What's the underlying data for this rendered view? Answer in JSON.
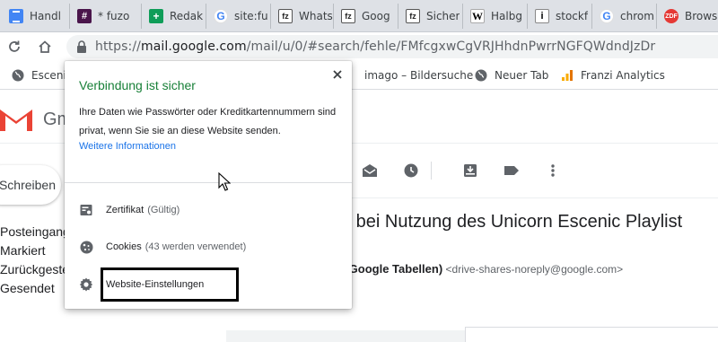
{
  "tabs": [
    {
      "label": "Handl",
      "icon": "google-docs-icon"
    },
    {
      "label": "* fuzo",
      "icon": "slack-icon"
    },
    {
      "label": "Redak",
      "icon": "google-sheets-icon"
    },
    {
      "label": "site:fu",
      "icon": "google-icon"
    },
    {
      "label": "Whats",
      "icon": "fz-icon"
    },
    {
      "label": "Goog",
      "icon": "fz-icon"
    },
    {
      "label": "Sicher",
      "icon": "fz-icon"
    },
    {
      "label": "Halbg",
      "icon": "wikipedia-icon"
    },
    {
      "label": "stockf",
      "icon": "istock-icon"
    },
    {
      "label": "chrom",
      "icon": "google-icon"
    },
    {
      "label": "Brows",
      "icon": "zdf-icon"
    }
  ],
  "omnibox": {
    "scheme": "https://",
    "host": "mail.google.com",
    "path": "/mail/u/0/#search/fehle/FMfcgxwCgVRJHhdnPwrrNGFQWdndJzDr"
  },
  "bookmarks": [
    {
      "label": "Escenic",
      "icon": "globe-icon"
    },
    {
      "label": "imago – Bildersuche",
      "icon": "none"
    },
    {
      "label": "Neuer Tab",
      "icon": "globe-icon"
    },
    {
      "label": "Franzi Analytics",
      "icon": "analytics-icon"
    }
  ],
  "gmail": {
    "logo_text": "Gm",
    "compose_label": "Schreiben",
    "nav": [
      "Posteingang",
      "Markiert",
      "Zurückgestellt",
      "Gesendet"
    ],
    "subject": "g bei Nutzung des Unicorn Escenic Playlist",
    "sender_name": "r Google Tabellen)",
    "sender_email": "<drive-shares-noreply@google.com>"
  },
  "popup": {
    "title": "Verbindung ist sicher",
    "description": "Ihre Daten wie Passwörter oder Kreditkartennummern sind privat, wenn Sie sie an diese Website senden.",
    "link": "Weitere Informationen",
    "rows": [
      {
        "label": "Zertifikat",
        "sub": "(Gültig)",
        "icon": "certificate-icon"
      },
      {
        "label": "Cookies",
        "sub": "(43 werden verwendet)",
        "icon": "cookie-icon"
      },
      {
        "label": "Website-Einstellungen",
        "sub": "",
        "icon": "gear-icon"
      }
    ]
  },
  "colors": {
    "secure_green": "#188038",
    "link_blue": "#1a73e8",
    "tabstrip_bg": "#dee1e6",
    "omnibox_bg": "#f1f3f4",
    "gmail_red": "#ea4335"
  }
}
